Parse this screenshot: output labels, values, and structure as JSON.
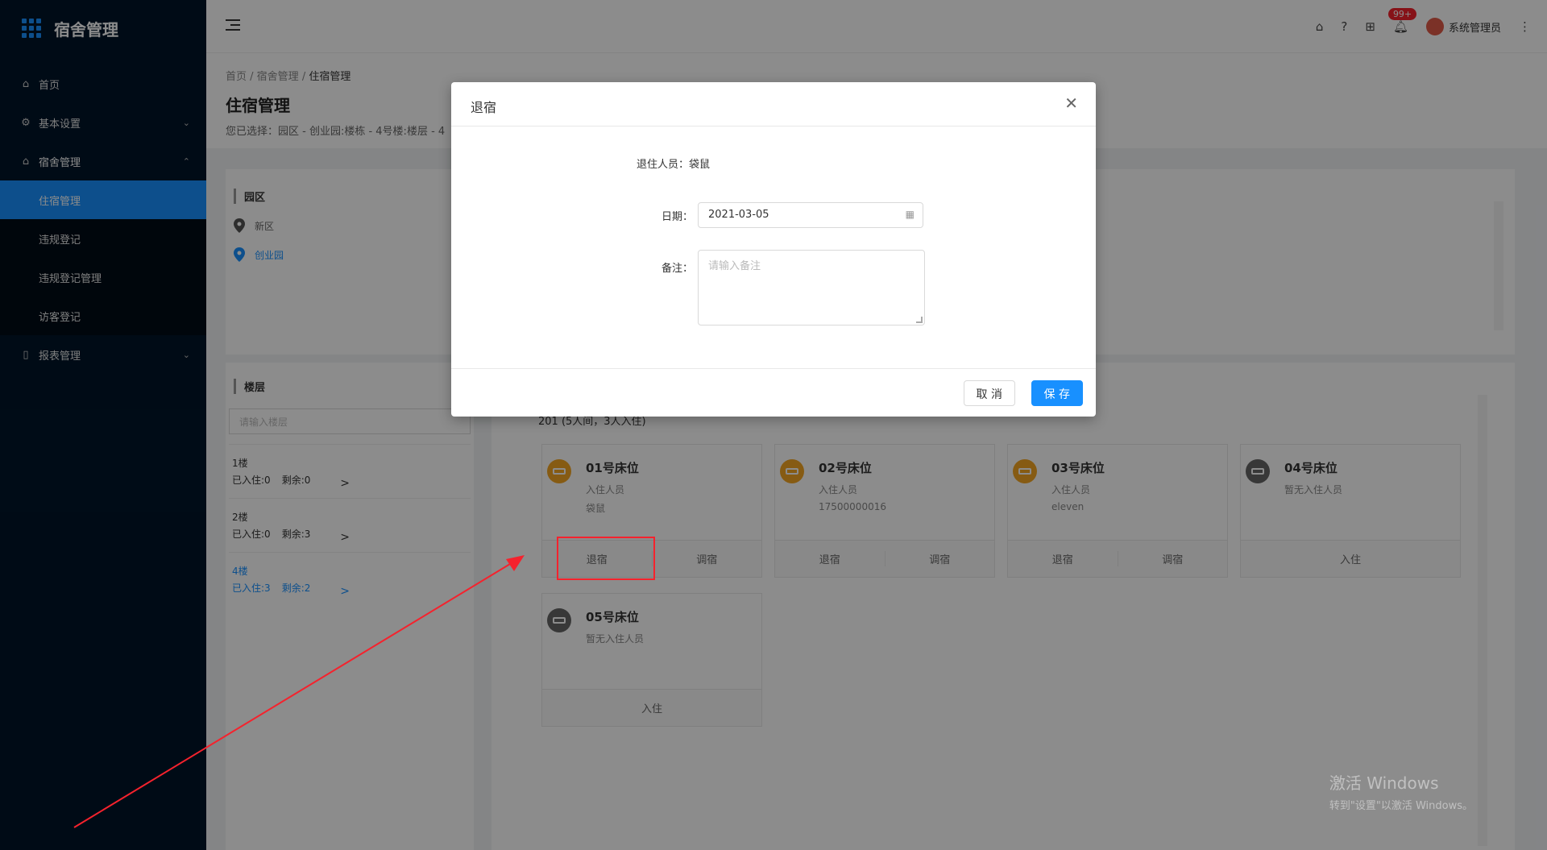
{
  "app": {
    "title": "宿舍管理"
  },
  "sidebar": {
    "items": [
      {
        "label": "首页",
        "icon": "home-icon"
      },
      {
        "label": "基本设置",
        "icon": "gear-icon"
      },
      {
        "label": "宿舍管理",
        "icon": "home-icon"
      },
      {
        "label": "报表管理",
        "icon": "book-icon"
      }
    ],
    "submenu": [
      "住宿管理",
      "违规登记",
      "违规登记管理",
      "访客登记"
    ]
  },
  "header": {
    "badge": "99+",
    "user": "系统管理员"
  },
  "breadcrumb": [
    "首页",
    "宿舍管理",
    "住宿管理"
  ],
  "page": {
    "title": "住宿管理",
    "selection": "您已选择：园区 - 创业园:楼栋 - 4号楼:楼层 - 4"
  },
  "park": {
    "label": "园区",
    "items": [
      "新区",
      "创业园"
    ]
  },
  "floor": {
    "label": "楼层",
    "placeholder": "请输入楼层",
    "items": [
      {
        "name": "1楼",
        "occupied": "已入住:0",
        "left": "剩余:0"
      },
      {
        "name": "2楼",
        "occupied": "已入住:0",
        "left": "剩余:3"
      },
      {
        "name": "4楼",
        "occupied": "已入住:3",
        "left": "剩余:2"
      }
    ]
  },
  "room": {
    "header": "201 (5人间，3人入住)"
  },
  "beds": [
    {
      "name": "01号床位",
      "label": "入住人员",
      "value": "袋鼠",
      "actions": [
        "退宿",
        "调宿"
      ]
    },
    {
      "name": "02号床位",
      "label": "入住人员",
      "value": "17500000016",
      "actions": [
        "退宿",
        "调宿"
      ]
    },
    {
      "name": "03号床位",
      "label": "入住人员",
      "value": "eleven",
      "actions": [
        "退宿",
        "调宿"
      ]
    },
    {
      "name": "04号床位",
      "label": "暂无入住人员",
      "value": "",
      "actions": [
        "入住"
      ]
    },
    {
      "name": "05号床位",
      "label": "暂无入住人员",
      "value": "",
      "actions": [
        "入住"
      ]
    }
  ],
  "modal": {
    "title": "退宿",
    "person_label": "退住人员：",
    "person_value": "袋鼠",
    "date_label": "日期：",
    "date_value": "2021-03-05",
    "note_label": "备注：",
    "note_placeholder": "请输入备注",
    "cancel": "取 消",
    "save": "保 存"
  },
  "watermark": {
    "line1": "激活 Windows",
    "line2": "转到\"设置\"以激活 Windows。"
  },
  "colors": {
    "primary": "#1890ff",
    "sidebar": "#001529",
    "occupied": "#f5a623",
    "annotation": "#f5222d"
  }
}
